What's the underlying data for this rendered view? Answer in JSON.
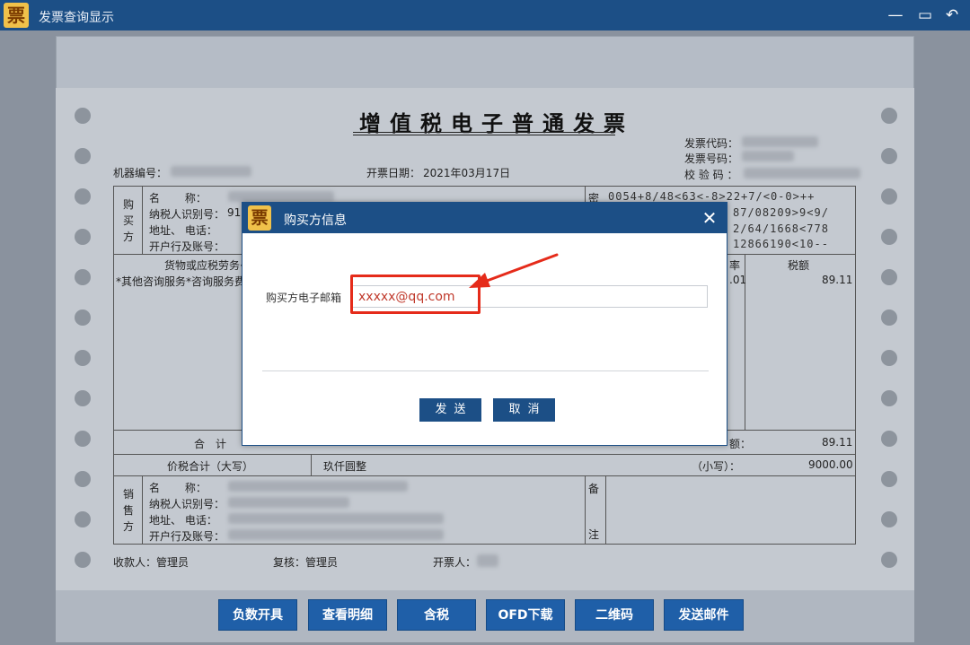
{
  "window": {
    "logo_char": "票",
    "title": "发票查询显示",
    "minimize_glyph": "—",
    "restore_glyph": "▭",
    "back_glyph": "↶"
  },
  "invoice": {
    "title": "增值税电子普通发票",
    "code_label": "发票代码：",
    "number_label": "发票号码：",
    "check_label": "校 验 码 ：",
    "machine_label": "机器编号：",
    "date_label": "开票日期：",
    "date_value": "2021年03月17日",
    "buyer_side": [
      "购",
      "买",
      "方"
    ],
    "seller_side": [
      "销",
      "售",
      "方"
    ],
    "buyer_fields": [
      "名 　　称：",
      "纳税人识别号：",
      "地址、  电话：",
      "开户行及账号："
    ],
    "seller_fields": [
      "名 　　称：",
      "纳税人识别号：",
      "地址、  电话：",
      "开户行及账号："
    ],
    "buyer_tax_id_partial": "91",
    "cipher_label": "密",
    "cipher_lines": [
      "0054+8/48<63<-8>22+7/<0-0>++",
      "87/08209>9<9/",
      "2/64/1668<778",
      "12866190<10--"
    ],
    "goods_header": "货物或应税劳务·",
    "rate_header": "率",
    "tax_header": "税额",
    "goods_item": "*其他咨询服务*咨询服务费",
    "rate_value": ".01",
    "tax_value": "89.11",
    "total_label": "合　计",
    "total_amount_label": "额：",
    "total_tax": "89.11",
    "price_total_label": "价税合计（大写）",
    "price_total_upper": "玖仟圆整",
    "price_small_label": "（小写）：",
    "price_total_small": "9000.00",
    "remark_top": "备",
    "remark_bottom": "注",
    "payee_label": "收款人：管理员",
    "reviewer_label": "复核：管理员",
    "issuer_label": "开票人："
  },
  "toolbar": {
    "buttons": [
      "负数开具",
      "查看明细",
      "含税",
      "OFD下载",
      "二维码",
      "发送邮件"
    ]
  },
  "dialog": {
    "title": "购买方信息",
    "close_glyph": "✕",
    "email_label": "购买方电子邮箱",
    "email_value": "xxxxx@qq.com",
    "send_label": "发送",
    "cancel_label": "取消"
  },
  "colors": {
    "accent": "#1c4f86",
    "button": "#1f5fa8",
    "highlight": "#e52b1a"
  }
}
